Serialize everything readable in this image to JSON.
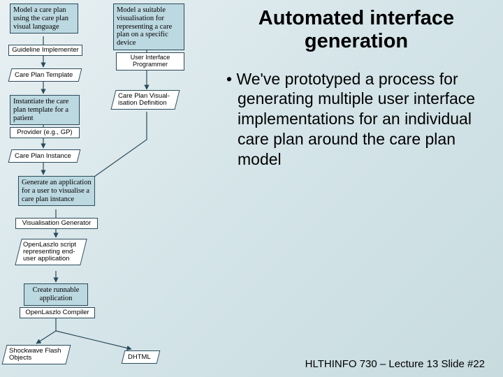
{
  "title_line1": "Automated interface",
  "title_line2": "generation",
  "bullet_text": "• We've prototyped a process for generating multiple user interface implementations for an individual care plan around the care plan model",
  "footer": "HLTHINFO 730 – Lecture 13 Slide #22",
  "diagram": {
    "top_left_box": "Model a care plan using the care plan visual language",
    "top_right_box": "Model a suitable visualisation for representing a care plan on a specific device",
    "role_guideline": "Guideline Implementer",
    "role_ui_prog": "User Interface Programmer",
    "care_plan_template": "Care Plan Template",
    "care_plan_vis_def1": "Care Plan Visual-",
    "care_plan_vis_def2": "isation Definition",
    "instantiate_box": "Instantiate the care plan template for a patient",
    "role_provider": "Provider (e.g., GP)",
    "care_plan_instance": "Care Plan Instance",
    "generate_box": "Generate an application for a user to visualise a care plan instance",
    "vis_generator": "Visualisation Generator",
    "openlaszlo_script1": "OpenLaszlo script",
    "openlaszlo_script2": "representing end-",
    "openlaszlo_script3": "user application",
    "create_runnable1": "Create runnable",
    "create_runnable2": "application",
    "openlaszlo_compiler": "OpenLaszlo Compiler",
    "shockwave1": "Shockwave Flash",
    "shockwave2": "Objects",
    "dhtml": "DHTML"
  }
}
